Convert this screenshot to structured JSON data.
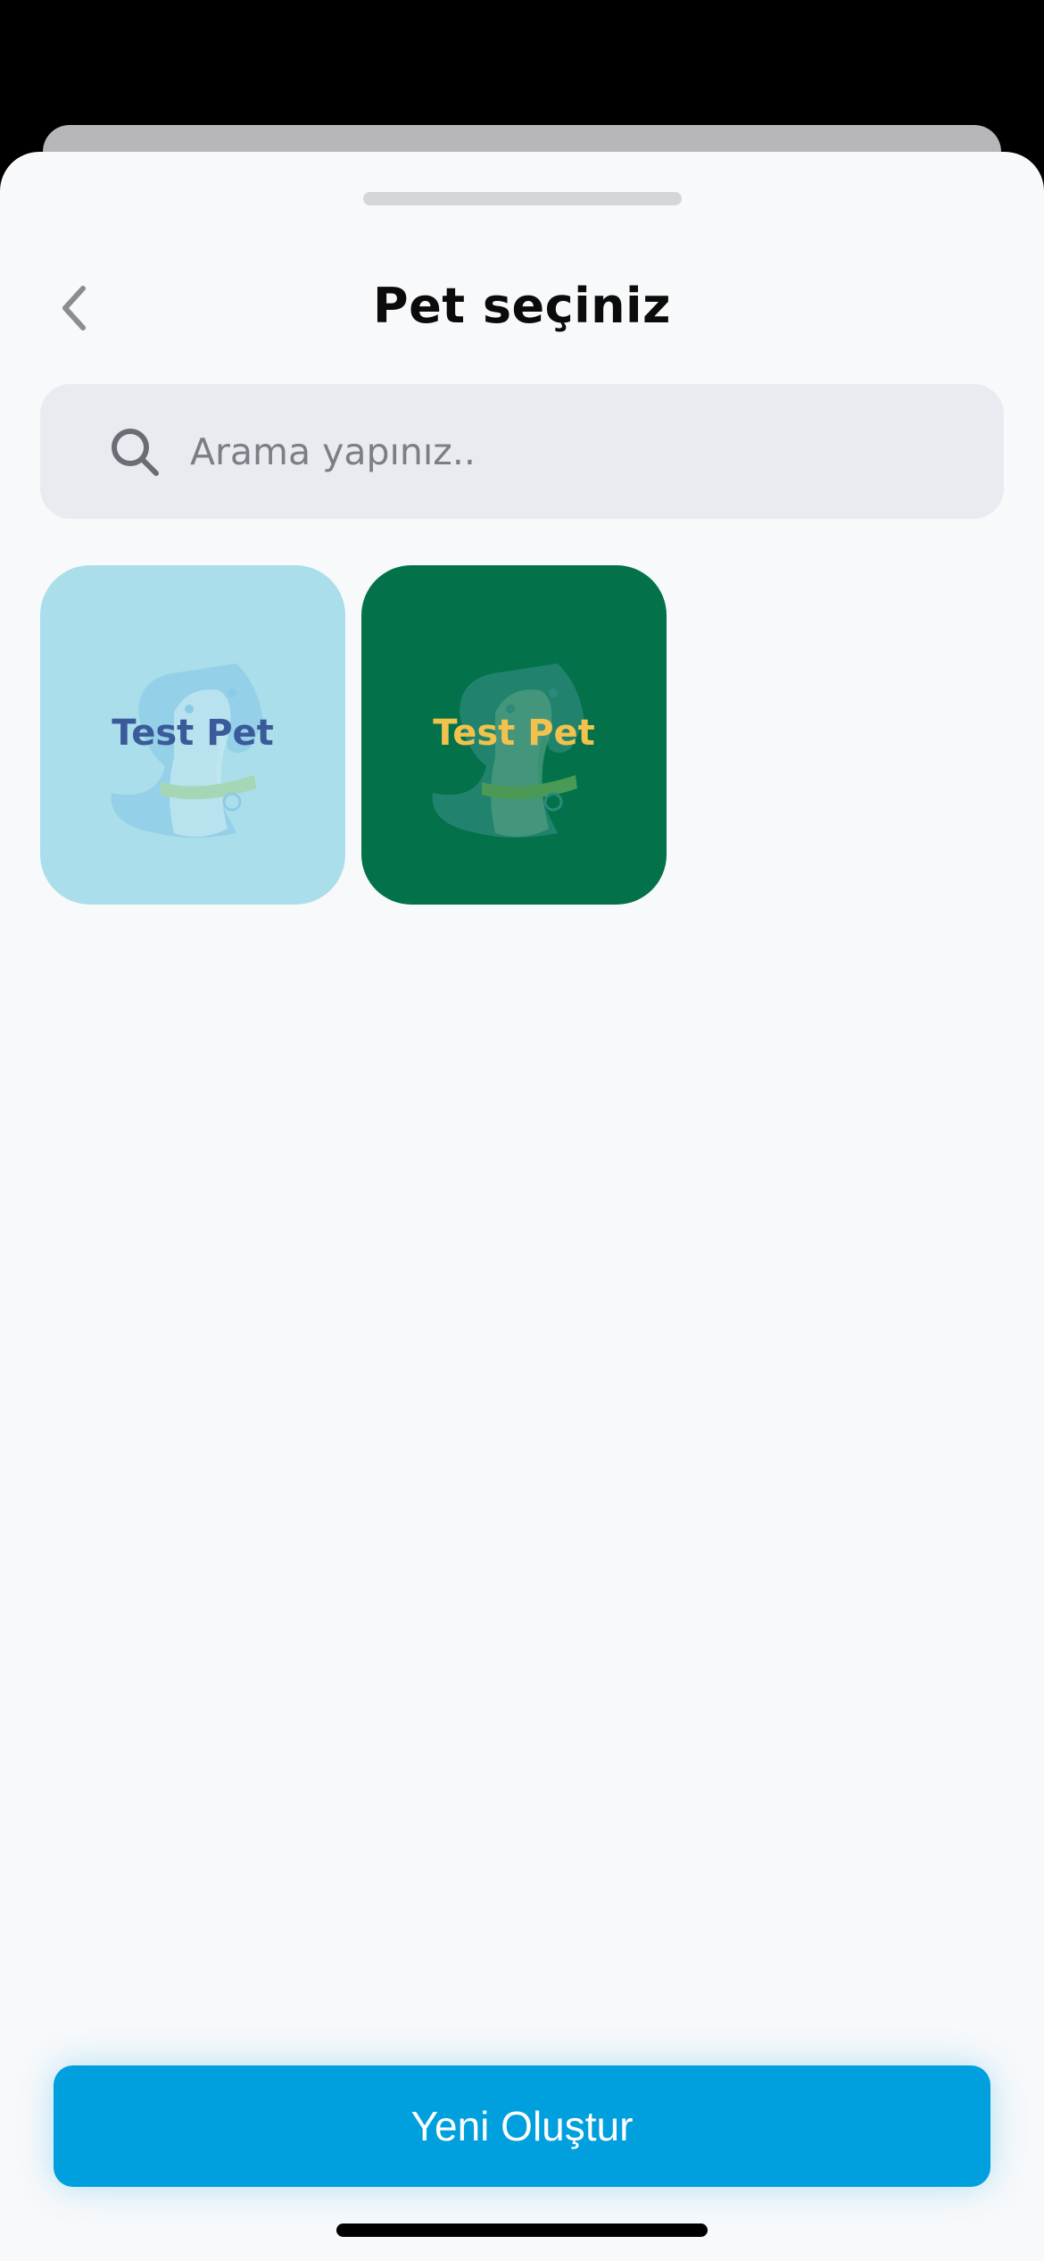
{
  "sheet": {
    "title": "Pet seçiniz",
    "back_icon": "chevron-left-icon"
  },
  "search": {
    "icon": "search-icon",
    "placeholder": "Arama yapınız.."
  },
  "pets": [
    {
      "name": "Test Pet",
      "card_color": "#aadeea",
      "name_color": "#3a5a9a",
      "art_colors": {
        "head": "#8ccbe6",
        "body": "#c6e8f1",
        "collar": "#a5d6b5"
      }
    },
    {
      "name": "Test Pet",
      "card_color": "#03714a",
      "name_color": "#f2c24c",
      "art_colors": {
        "head": "#2c8a7a",
        "body": "#4f9c82",
        "collar": "#4a9a55"
      }
    }
  ],
  "actions": {
    "create_label": "Yeni Oluştur",
    "accent_color": "#00a0df"
  }
}
